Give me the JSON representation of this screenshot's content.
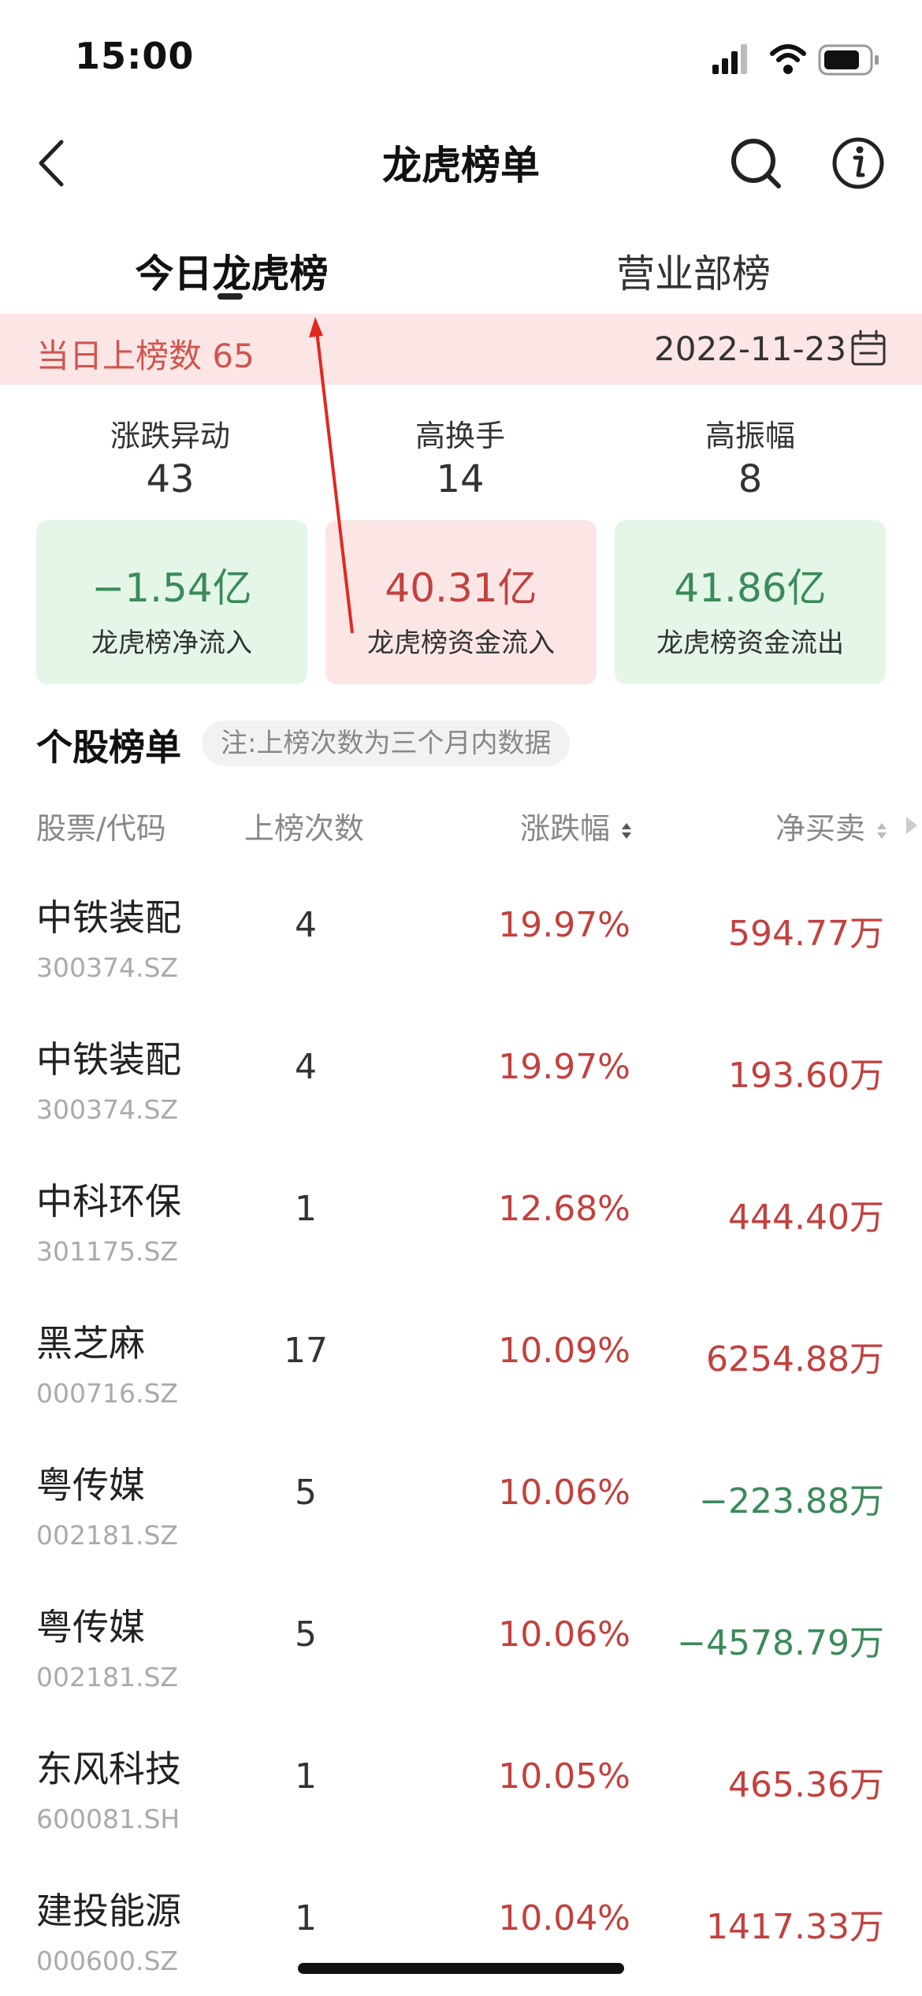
{
  "status_bar": {
    "time": "15:00"
  },
  "nav": {
    "title": "龙虎榜单"
  },
  "tabs": [
    {
      "label": "今日龙虎榜",
      "active": true
    },
    {
      "label": "营业部榜",
      "active": false
    }
  ],
  "banner": {
    "count_text": "当日上榜数 65",
    "date": "2022-11-23"
  },
  "stats": [
    {
      "label": "涨跌异动",
      "value": "43"
    },
    {
      "label": "高换手",
      "value": "14"
    },
    {
      "label": "高振幅",
      "value": "8"
    }
  ],
  "cards": [
    {
      "value": "−1.54亿",
      "label": "龙虎榜净流入"
    },
    {
      "value": "40.31亿",
      "label": "龙虎榜资金流入"
    },
    {
      "value": "41.86亿",
      "label": "龙虎榜资金流出"
    }
  ],
  "section": {
    "title": "个股榜单",
    "note": "注:上榜次数为三个月内数据"
  },
  "table": {
    "headers": {
      "stock": "股票/代码",
      "count": "上榜次数",
      "change": "涨跌幅",
      "net": "净买卖"
    },
    "rows": [
      {
        "name": "中铁装配",
        "code": "300374.SZ",
        "count": "4",
        "change": "19.97%",
        "net": "594.77万",
        "net_positive": true
      },
      {
        "name": "中铁装配",
        "code": "300374.SZ",
        "count": "4",
        "change": "19.97%",
        "net": "193.60万",
        "net_positive": true
      },
      {
        "name": "中科环保",
        "code": "301175.SZ",
        "count": "1",
        "change": "12.68%",
        "net": "444.40万",
        "net_positive": true
      },
      {
        "name": "黑芝麻",
        "code": "000716.SZ",
        "count": "17",
        "change": "10.09%",
        "net": "6254.88万",
        "net_positive": true
      },
      {
        "name": "粤传媒",
        "code": "002181.SZ",
        "count": "5",
        "change": "10.06%",
        "net": "−223.88万",
        "net_positive": false
      },
      {
        "name": "粤传媒",
        "code": "002181.SZ",
        "count": "5",
        "change": "10.06%",
        "net": "−4578.79万",
        "net_positive": false
      },
      {
        "name": "东风科技",
        "code": "600081.SH",
        "count": "1",
        "change": "10.05%",
        "net": "465.36万",
        "net_positive": true
      },
      {
        "name": "建投能源",
        "code": "000600.SZ",
        "count": "1",
        "change": "10.04%",
        "net": "1417.33万",
        "net_positive": true
      }
    ]
  },
  "colors": {
    "up": "#c2413e",
    "down": "#3b8a5a",
    "arrow": "#e0281f"
  }
}
